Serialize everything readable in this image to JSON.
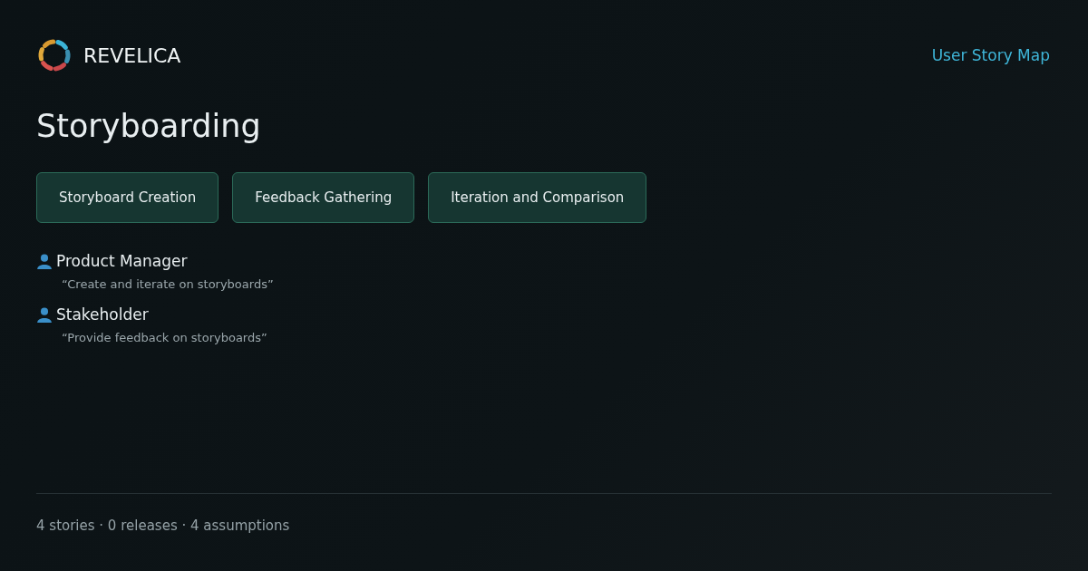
{
  "header": {
    "brand": "REVELICA",
    "link": "User Story Map"
  },
  "title": "Storyboarding",
  "activities": [
    {
      "label": "Storyboard Creation"
    },
    {
      "label": "Feedback Gathering"
    },
    {
      "label": "Iteration and Comparison"
    }
  ],
  "personas": [
    {
      "name": "Product Manager",
      "quote": "“Create and iterate on storyboards”"
    },
    {
      "name": "Stakeholder",
      "quote": "“Provide feedback on storyboards”"
    }
  ],
  "footer": "4 stories · 0 releases · 4 assumptions"
}
